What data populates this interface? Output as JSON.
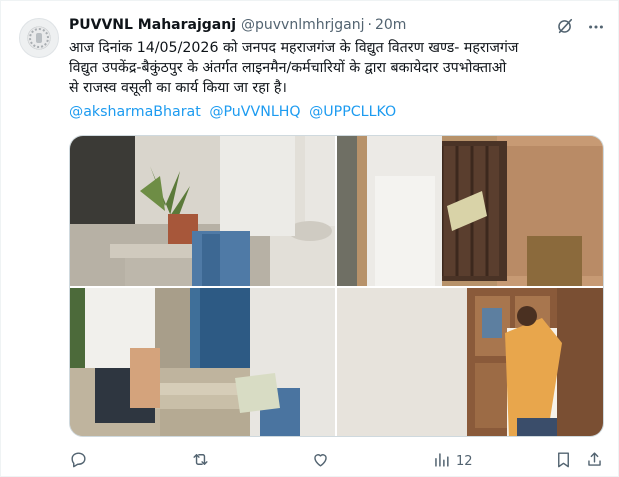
{
  "tweet": {
    "display_name": "PUVVNL Maharajganj",
    "handle": "@puvvnlmhrjganj",
    "separator": "·",
    "time": "20m",
    "text_lines": [
      "आज दिनांक 14/05/2026 को जनपद महराजगंज के विद्युत वितरण खण्ड- महराजगंज",
      "विद्युत उपकेंद्र-बैकुंठपुर के अंतर्गत लाइनमैन/कर्मचारियों के द्वारा बकायेदार उपभोक्ताओ",
      "से राजस्व वसूली का कार्य किया जा रहा है।"
    ],
    "mentions": [
      "@aksharmaBharat",
      "@PuVVNLHQ",
      "@UPPCLLKO"
    ],
    "views_count": "12"
  },
  "colors": {
    "link": "#1d9bf0",
    "secondary_text": "#536471",
    "primary_text": "#0f1419",
    "border": "#cfd9de"
  },
  "icons": {
    "header": [
      "grok-icon",
      "more-icon"
    ],
    "actions": [
      "reply-icon",
      "repost-icon",
      "like-icon",
      "views-icon",
      "bookmark-icon",
      "share-icon"
    ]
  }
}
